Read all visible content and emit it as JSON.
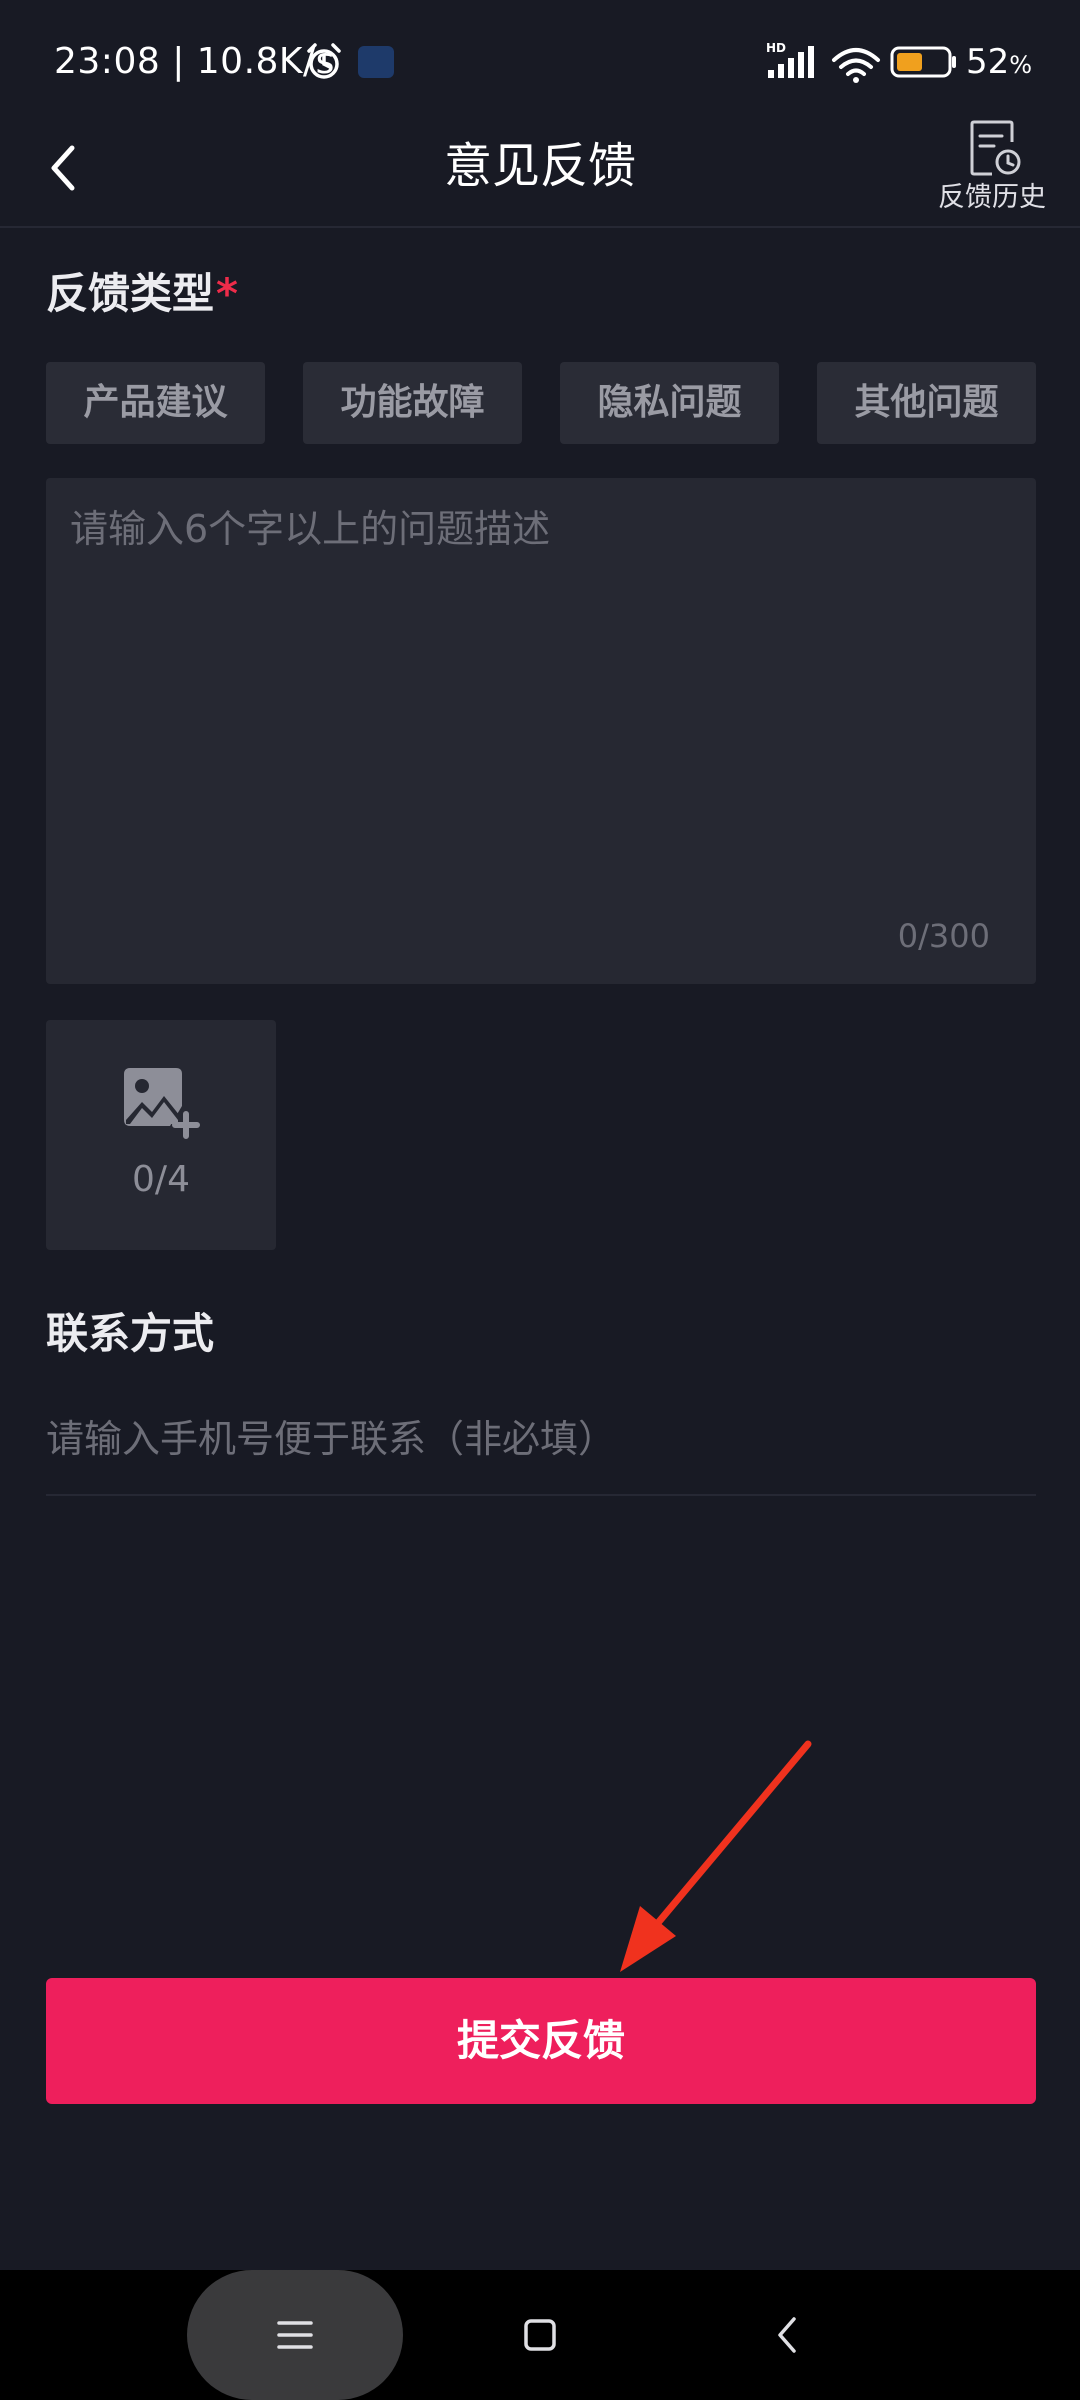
{
  "status_bar": {
    "time": "23:08 | 10.8K/s",
    "battery_percent": "52",
    "battery_unit": "%",
    "battery_level": 0.52,
    "network_label": "HD",
    "icons": [
      "alarm-icon",
      "app-notification-icon",
      "signal-icon",
      "wifi-icon",
      "battery-icon"
    ]
  },
  "header": {
    "title": "意见反馈",
    "back_icon": "chevron-left-icon",
    "history_label": "反馈历史",
    "history_icon": "history-document-icon"
  },
  "feedback_type": {
    "title": "反馈类型",
    "required_mark": "*",
    "options": [
      "产品建议",
      "功能故障",
      "隐私问题",
      "其他问题"
    ]
  },
  "description": {
    "value": "",
    "placeholder": "请输入6个字以上的问题描述",
    "counter": "0/300"
  },
  "images": {
    "counter": "0/4",
    "icon": "add-image-icon"
  },
  "contact": {
    "title": "联系方式",
    "value": "",
    "placeholder": "请输入手机号便于联系（非必填）"
  },
  "submit": {
    "label": "提交反馈"
  },
  "colors": {
    "background": "#181a24",
    "chip": "#2a2c36",
    "input_box": "#262832",
    "accent": "#ee1f5c",
    "required": "#ee2c4a",
    "annotation_arrow": "#f0321e",
    "battery_fill": "#f0a01e"
  },
  "nav_bar": {
    "icons": [
      "menu-icon",
      "home-square-icon",
      "back-chevron-icon"
    ]
  }
}
